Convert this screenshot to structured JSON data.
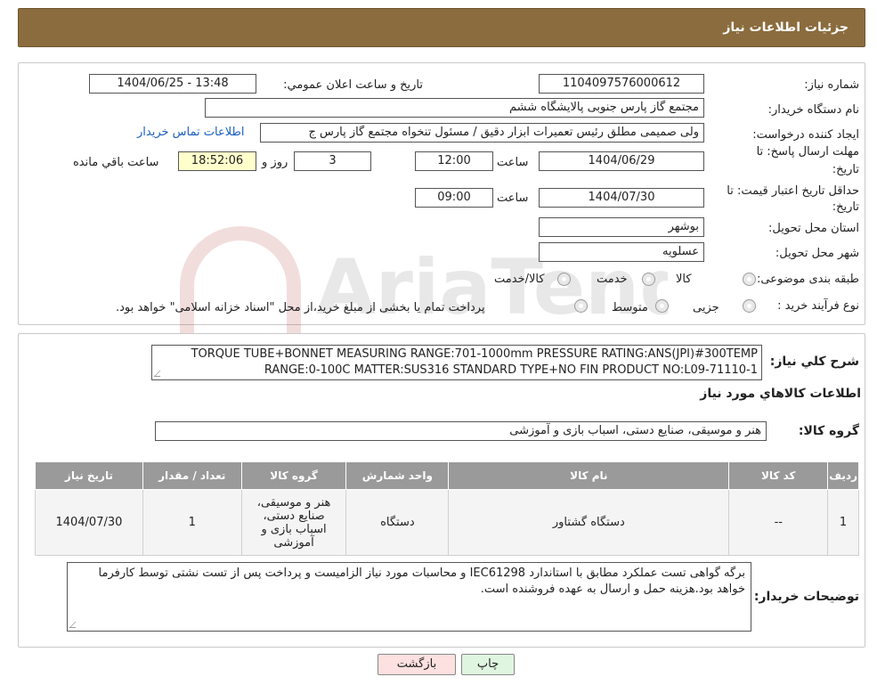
{
  "header": {
    "title": "جزئیات اطلاعات نیاز"
  },
  "form": {
    "need_number_label": "شماره نیاز:",
    "need_number": "1104097576000612",
    "announce_label": "تاریخ و ساعت اعلان عمومي:",
    "announce_value": "1404/06/25 - 13:48",
    "buyer_org_label": "نام دستگاه خریدار:",
    "buyer_org": "مجتمع گاز پارس جنوبی  پالایشگاه ششم",
    "requester_label": "ایجاد کننده درخواست:",
    "requester": "ولی صمیمی مطلق رئیس تعمیرات ابزار دقیق / مسئول تنخواه مجتمع گاز پارس ج",
    "contact_link": "اطلاعات تماس خریدار",
    "deadline_label_1": "مهلت ارسال پاسخ: تا",
    "deadline_label_2": "تاریخ:",
    "deadline_date": "1404/06/29",
    "time_label": "ساعت",
    "deadline_time": "12:00",
    "days_value": "3",
    "days_label": "روز و",
    "remaining_time": "18:52:06",
    "remaining_label": "ساعت باقي مانده",
    "validity_label_1": "حداقل تاریخ اعتبار قیمت: تا",
    "validity_label_2": "تاریخ:",
    "validity_date": "1404/07/30",
    "validity_time": "09:00",
    "province_label": "استان محل تحویل:",
    "province": "بوشهر",
    "city_label": "شهر محل تحویل:",
    "city": "عسلویه",
    "category_label": "طبقه بندی موضوعی:",
    "category_options": [
      "کالا",
      "خدمت",
      "کالا/خدمت"
    ],
    "purchase_type_label": "نوع فرآیند خرید :",
    "purchase_options": [
      "جزیی",
      "متوسط"
    ],
    "purchase_note": "پرداخت تمام یا بخشی از مبلغ خرید،از محل \"اسناد خزانه اسلامی\" خواهد بود."
  },
  "details": {
    "summary_label": "شرح كلي نياز:",
    "summary_line1": "TORQUE TUBE+BONNET MEASURING RANGE:701-1000mm PRESSURE RATING:ANS(JPI)#300TEMP",
    "summary_line2": "RANGE:0-100C MATTER:SUS316 STANDARD TYPE+NO FIN PRODUCT NO:L09-71110-1",
    "goods_info_title": "اطلاعات كالاهاي مورد نياز",
    "goods_group_label": "گروه كالا:",
    "goods_group": "هنر و موسیقی، صنایع دستی، اسباب بازی و آموزشی"
  },
  "table": {
    "headers": [
      "ردیف",
      "کد کالا",
      "نام کالا",
      "واحد شمارش",
      "گروه کالا",
      "تعداد / مقدار",
      "تاریخ نیاز"
    ],
    "rows": [
      {
        "row": "1",
        "code": "--",
        "name": "دستگاه گشتاور",
        "unit": "دستگاه",
        "group": "هنر و موسیقی، صنایع دستی، اسباب بازی و آموزشی",
        "qty": "1",
        "date": "1404/07/30"
      }
    ]
  },
  "buyer_notes": {
    "label": "توضیحات خریدار:",
    "text": "برگه گواهی تست عملکرد مطابق با استاندارد IEC61298 و محاسبات مورد نیاز الزامیست و پرداخت پس از تست نشتی توسط کارفرما خواهد بود.هزینه حمل و ارسال به عهده فروشنده است."
  },
  "buttons": {
    "print": "چاپ",
    "back": "بازگشت"
  },
  "watermark": {
    "text": "AriaTender.neT"
  },
  "colors": {
    "header_bg": "#8b6c3e",
    "link": "#1a5fbf",
    "yellow_field": "#ffffcc",
    "back_button": "#fde0e0",
    "print_button": "#e0f5e0"
  }
}
